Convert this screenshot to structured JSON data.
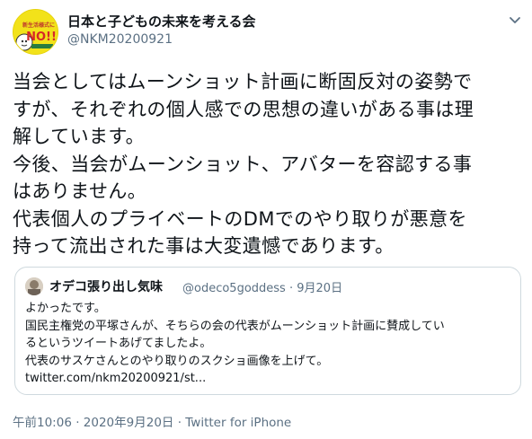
{
  "tweet": {
    "avatar": {
      "badge_line1": "新生活様式に",
      "badge_line2": "NO!!"
    },
    "display_name": "日本と子どもの未来を考える会",
    "handle": "@NKM20200921",
    "text": "当会としてはムーンショット計画に断固反対の姿勢で\nすが、それぞれの個人感での思想の違いがある事は理\n解しています。\n今後、当会がムーンショット、アバターを容認する事\nはありません。\n代表個人のプライベートのDMでのやり取りが悪意を\n持って流出された事は大変遺憾であります。",
    "footer": {
      "time": "午前10:06",
      "separator1": " · ",
      "date": "2020年9月20日",
      "separator2": " · ",
      "source": "Twitter for iPhone"
    }
  },
  "quote": {
    "display_name": "オデコ張り出し気味",
    "handle": "@odeco5goddess",
    "separator": " · ",
    "date": "9月20日",
    "text": "よかったです。\n国民主権党の平塚さんが、そちらの会の代表がムーンショット計画に賛成してい\nるというツイートあげてましたよ。\n代表のサスケさんとのやり取りのスクショ画像を上げて。",
    "link": "twitter.com/nkm20200921/st..."
  },
  "colors": {
    "text": "#0f1419",
    "secondary": "#5b7083",
    "border": "#cfd9de",
    "avatar_yellow": "#f2e21a"
  },
  "icons": {
    "menu": "chevron-down-icon"
  }
}
